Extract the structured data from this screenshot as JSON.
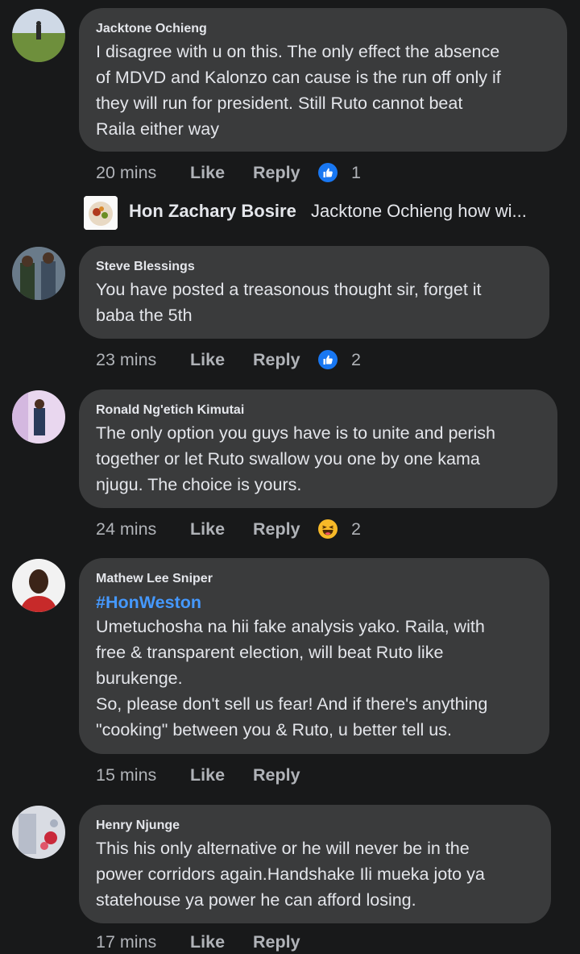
{
  "comments": [
    {
      "author": "Jacktone Ochieng",
      "text": "I disagree with u on this. The only effect the absence\nof MDVD and Kalonzo can cause is the run off only if\nthey will run for president. Still Ruto cannot beat\nRaila either way",
      "time": "20 mins",
      "like_label": "Like",
      "reply_label": "Reply",
      "reaction_icon": "like-reaction-icon",
      "reaction_count": "1"
    },
    {
      "author": "Steve Blessings",
      "text": "You have posted a treasonous thought sir, forget it\nbaba the 5th",
      "time": "23 mins",
      "like_label": "Like",
      "reply_label": "Reply",
      "reaction_icon": "like-reaction-icon",
      "reaction_count": "2"
    },
    {
      "author": "Ronald Ng'etich Kimutai",
      "text": "The only option you guys have is to unite and perish\ntogether or let Ruto swallow you one by one kama\nnjugu. The choice is yours.",
      "time": "24 mins",
      "like_label": "Like",
      "reply_label": "Reply",
      "reaction_icon": "haha-reaction-icon",
      "reaction_count": "2"
    },
    {
      "author": "Mathew Lee Sniper",
      "hashtag": "#HonWeston",
      "text": "Umetuchosha na hii fake analysis yako. Raila, with\nfree & transparent election, will beat Ruto like\nburukenge.\nSo, please don't sell us fear! And if there's anything\n\"cooking\" between you & Ruto, u better tell us.",
      "time": "15 mins",
      "like_label": "Like",
      "reply_label": "Reply"
    },
    {
      "author": "Henry Njunge",
      "text": "This his only alternative or he will never be in the\npower corridors again.Handshake Ili mueka joto ya\nstatehouse ya power he can afford  losing.",
      "time": "17 mins",
      "like_label": "Like",
      "reply_label": "Reply"
    }
  ],
  "reply_preview": {
    "author": "Hon Zachary Bosire",
    "snippet": "Jacktone Ochieng how wi..."
  },
  "colors": {
    "background": "#18191a",
    "bubble": "#3a3b3c",
    "primary_text": "#e4e6eb",
    "secondary_text": "#b0b3b8",
    "hashtag": "#4599ff",
    "like_blue": "#1877f2",
    "haha_yellow": "#f7b928"
  }
}
